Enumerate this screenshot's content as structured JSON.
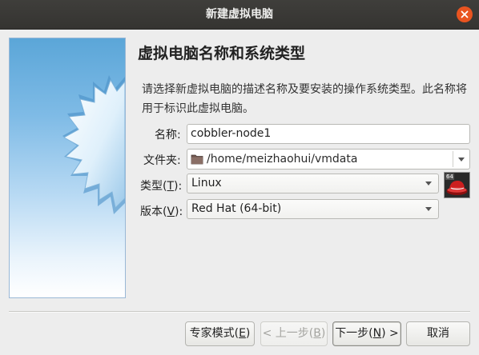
{
  "window": {
    "title": "新建虚拟电脑"
  },
  "page": {
    "heading": "虚拟电脑名称和系统类型",
    "description": "请选择新虚拟电脑的描述名称及要安装的操作系统类型。此名称将用于标识此虚拟电脑。"
  },
  "form": {
    "name_label": "名称:",
    "name_value": "cobbler-node1",
    "folder_label": "文件夹:",
    "folder_value": "/home/meizhaohui/vmdata",
    "type_label_prefix": "类型(",
    "type_label_key": "T",
    "type_label_suffix": "):",
    "type_value": "Linux",
    "version_label_prefix": "版本(",
    "version_label_key": "V",
    "version_label_suffix": "):",
    "version_value": "Red Hat (64-bit)",
    "os_badge": "64"
  },
  "buttons": {
    "expert_prefix": "专家模式(",
    "expert_key": "E",
    "expert_suffix": ")",
    "back_prefix": "< 上一步(",
    "back_key": "B",
    "back_suffix": ")",
    "next_prefix": "下一步(",
    "next_key": "N",
    "next_suffix": ") >",
    "cancel_label": "取消"
  },
  "colors": {
    "titlebar": "#3c3b37",
    "close_button": "#e95420",
    "background": "#ededed"
  },
  "icons": {
    "close": "close-icon",
    "folder": "folder-icon",
    "os": "redhat-os-icon",
    "dropdown": "chevron-down-icon"
  }
}
